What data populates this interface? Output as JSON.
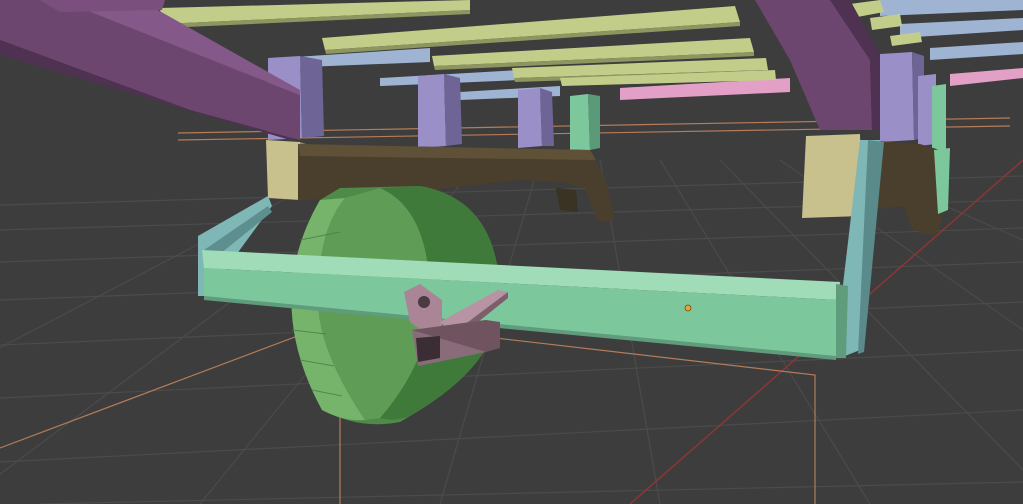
{
  "app": "3D Viewport",
  "colors": {
    "background": "#3d3d3d",
    "grid_line": "#4a4a4a",
    "x_axis": "#9b3a3a",
    "bounds_wire": "#c98a62",
    "deck_slat": "#c3cd8a",
    "frame_purple": "#7a4f7d",
    "post_lilac": "#9b8fc7",
    "post_blue": "#9fb4d2",
    "bracket_tan": "#c8c08d",
    "leaf_spring": "#4a3f2c",
    "axle_green": "#7dc79d",
    "tire_green": "#6fa867",
    "hitch_mauve": "#a98595",
    "hanger_teal": "#7fb7b7",
    "origin_dot": "#e9a533"
  },
  "objects": [
    {
      "name": "deck-slats",
      "material": "deck_slat"
    },
    {
      "name": "frame-beams",
      "material": "frame_purple"
    },
    {
      "name": "support-posts",
      "material": "post_lilac"
    },
    {
      "name": "spring-bracket",
      "material": "bracket_tan"
    },
    {
      "name": "leaf-spring",
      "material": "leaf_spring"
    },
    {
      "name": "axle-beam",
      "material": "axle_green"
    },
    {
      "name": "wheel",
      "material": "tire_green"
    },
    {
      "name": "hitch-mount",
      "material": "hitch_mauve"
    },
    {
      "name": "hanger-plate",
      "material": "hanger_teal"
    }
  ]
}
